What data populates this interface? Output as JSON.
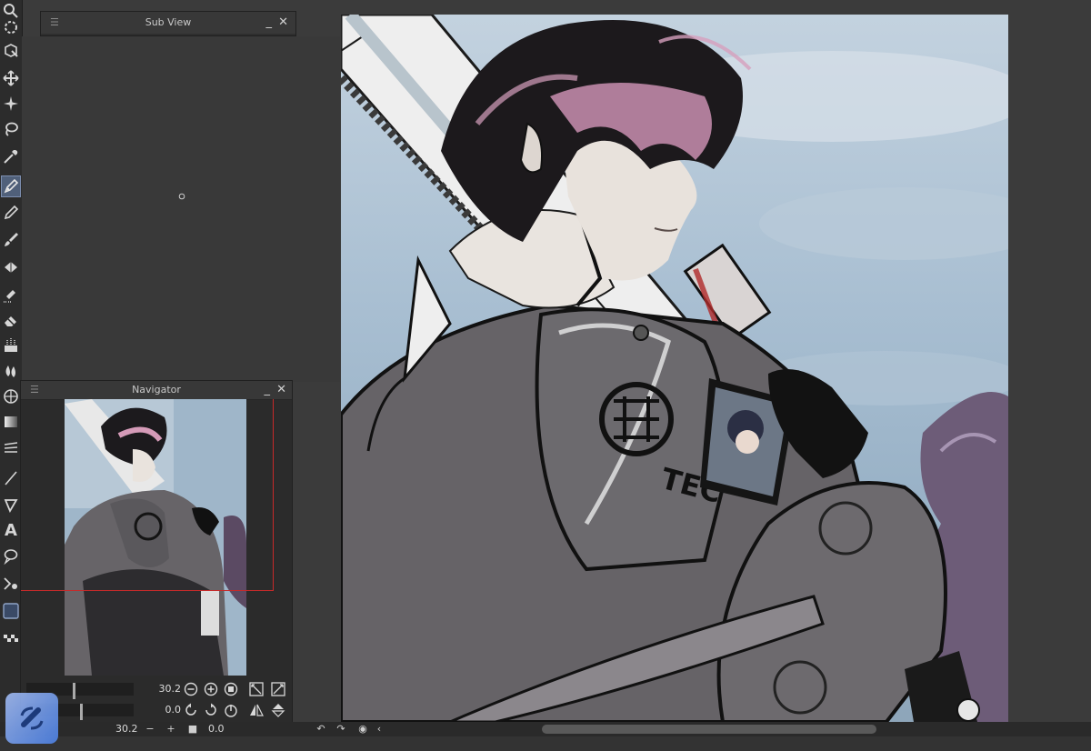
{
  "subview": {
    "title": "Sub View",
    "minimize_glyph": "_",
    "close_glyph": "✕",
    "menu_glyph": "☰"
  },
  "navigator": {
    "title": "Navigator",
    "minimize_glyph": "_",
    "close_glyph": "✕",
    "menu_glyph": "☰",
    "zoom_value": "30.2",
    "rotate_value": "0.0"
  },
  "statusbar": {
    "zoom_value": "30.2",
    "angle_value": "0.0",
    "minus_glyph": "−",
    "plus_glyph": "+",
    "left_arrow": "‹"
  },
  "toolbar": {
    "tools": [
      "zoom-icon",
      "move-view-icon",
      "object-select-icon",
      "move-layer-icon",
      "auto-select-icon",
      "lasso-select-icon",
      "eyedropper-icon",
      "pen-icon",
      "pencil-icon",
      "brush-icon",
      "airbrush-icon",
      "decoration-icon",
      "eraser-icon",
      "blend-icon",
      "fill-icon",
      "gradient-icon",
      "ruler-icon",
      "frame-icon",
      "line-icon",
      "figure-icon",
      "text-icon",
      "balloon-icon",
      "correct-line-icon",
      "color-swatch-icon"
    ],
    "text_tool_glyph": "A",
    "active_tool": "pen-icon"
  },
  "colors": {
    "accent": "#50607a",
    "navigator_frame": "#c62a2a",
    "panel_bg": "#2e2e2e",
    "workspace_bg": "#3b3b3b"
  },
  "artwork": {
    "emblem_text": "TEC"
  }
}
